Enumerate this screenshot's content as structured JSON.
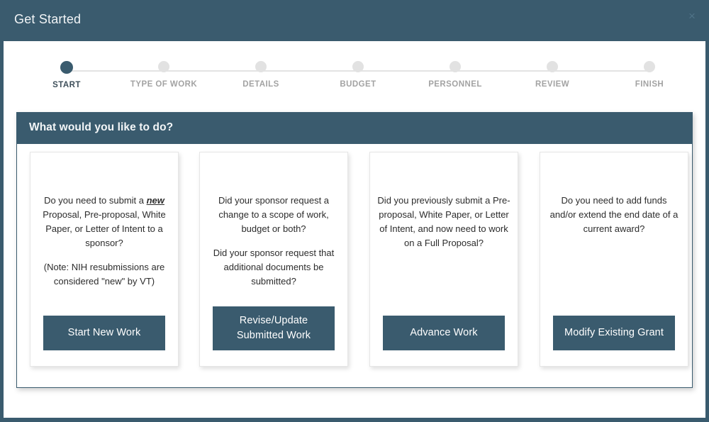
{
  "window": {
    "title": "Get Started",
    "close_icon": "close-icon",
    "close_glyph": "×",
    "accent_color": "#3a5b6e",
    "card_border_color": "#e6e6e6",
    "inactive_step_color": "#e2e2e2"
  },
  "stepper": {
    "steps": [
      {
        "label": "START",
        "active": true
      },
      {
        "label": "TYPE OF WORK",
        "active": false
      },
      {
        "label": "DETAILS",
        "active": false
      },
      {
        "label": "BUDGET",
        "active": false
      },
      {
        "label": "PERSONNEL",
        "active": false
      },
      {
        "label": "REVIEW",
        "active": false
      },
      {
        "label": "FINISH",
        "active": false
      }
    ]
  },
  "panel": {
    "header_title": "What would you like to do?",
    "cards": [
      {
        "paragraph1_before": "Do you need to submit a ",
        "paragraph1_emphasis": "new",
        "paragraph1_after": " Proposal, Pre-proposal, White Paper, or Letter of Intent to a sponsor?",
        "paragraph2": "(Note: NIH resubmissions are considered \"new\" by VT)",
        "button_label": "Start New Work"
      },
      {
        "paragraph1": "Did your sponsor request a change to a scope of work, budget or both?",
        "paragraph2": "Did your sponsor request that additional documents be submitted?",
        "button_label_line1": "Revise/Update",
        "button_label_line2": "Submitted Work"
      },
      {
        "paragraph1": "Did you previously submit a Pre-proposal, White Paper, or Letter of Intent, and now need to work on a Full Proposal?",
        "button_label": "Advance Work"
      },
      {
        "paragraph1": "Do you need to add funds and/or extend the end date of a current award?",
        "button_label": "Modify Existing Grant"
      }
    ]
  }
}
